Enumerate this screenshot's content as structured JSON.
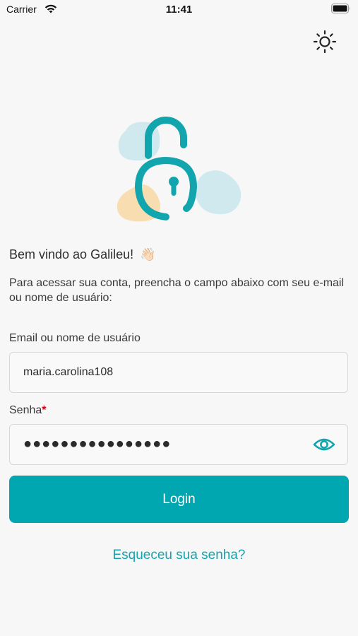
{
  "status_bar": {
    "carrier": "Carrier",
    "time": "11:41"
  },
  "header": {
    "theme_icon": "sun-icon"
  },
  "illustration": {
    "icon": "unlocked-padlock-icon",
    "colors": {
      "lock": "#12a5ae",
      "blob_blue": "#cfe9ee",
      "blob_orange": "#f8ddb1"
    }
  },
  "welcome": {
    "title": "Bem vindo ao Galileu!",
    "emoji": "👋🏻",
    "instructions": "Para acessar sua conta, preencha o campo abaixo com seu e-mail ou nome de usuário:"
  },
  "form": {
    "email_label": "Email ou nome de usuário",
    "email_value": "maria.carolina108",
    "password_label": "Senha",
    "password_required_mark": "*",
    "password_value": "●●●●●●●●●●●●●●●●",
    "show_password_icon": "eye-icon"
  },
  "actions": {
    "login_label": "Login",
    "forgot_label": "Esqueceu sua senha?"
  },
  "colors": {
    "accent": "#00a7b1",
    "link": "#12a5ae",
    "required": "#d0021b",
    "background": "#f7f7f7"
  }
}
